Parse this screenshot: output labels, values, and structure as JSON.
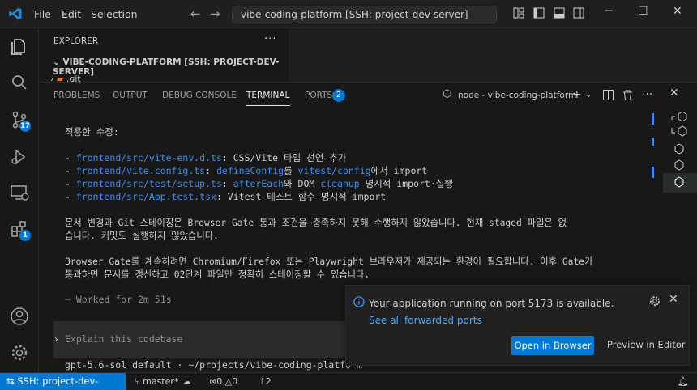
{
  "titlebar": {
    "menus": [
      "File",
      "Edit",
      "Selection"
    ],
    "command_center": "vibe-coding-platform [SSH: project-dev-server]"
  },
  "activity": {
    "source_control_badge": "17",
    "extensions_badge": "1"
  },
  "sidebar": {
    "title": "EXPLORER",
    "more": "···",
    "project": "VIBE-CODING-PLATFORM [SSH: PROJECT-DEV-SERVER]",
    "first_item": ".git"
  },
  "panel": {
    "tabs": [
      "PROBLEMS",
      "OUTPUT",
      "DEBUG CONSOLE",
      "TERMINAL",
      "PORTS"
    ],
    "active_tab": "TERMINAL",
    "ports_badge": "2",
    "terminal_name": "node - vibe-coding-platform"
  },
  "terminal": {
    "heading": "적용한 수정:",
    "items": [
      {
        "path": "frontend/src/vite-env.d.ts",
        "rest": ": CSS/Vite 타입 선언 추가"
      },
      {
        "path": "frontend/vite.config.ts",
        "mid1": ": ",
        "code1": "defineConfig",
        "mid2": "를 ",
        "code2": "vitest/config",
        "rest": "에서 import"
      },
      {
        "path": "frontend/src/test/setup.ts",
        "mid1": ": ",
        "code1": "afterEach",
        "mid2": "와 DOM ",
        "code2": "cleanup",
        "rest": " 명시적 import·실행"
      },
      {
        "path": "frontend/src/App.test.tsx",
        "rest": ": Vitest 테스트 함수 명시적 import"
      }
    ],
    "para1_line1": "문서 변경과 Git 스테이징은 Browser Gate 통과 조건을 충족하지 못해 수행하지 않았습니다. 현재 staged 파일은 없",
    "para1_line2": "습니다. 커밋도 실행하지 않았습니다.",
    "para2_line1": "Browser Gate를 계속하려면 Chromium/Firefox 또는 Playwright 브라우저가 제공되는 환경이 필요합니다. 이후 Gate가",
    "para2_line2": "통과하면 문서를 갱신하고 02단계 파일만 정확히 스테이징할 수 있습니다.",
    "worked": "─ Worked for 2m 51s ",
    "prompt_symbol": "›",
    "prompt_placeholder": "Explain this codebase",
    "footer": "gpt-5.6-sol default · ~/projects/vibe-coding-platform"
  },
  "notification": {
    "message": "Your application running on port 5173 is available.",
    "link": "See all forwarded ports",
    "primary": "Open in Browser",
    "secondary": "Preview in Editor"
  },
  "statusbar": {
    "remote": "SSH: project-dev-server",
    "branch": "master*",
    "errors": "0",
    "warnings": "0",
    "ports": "2"
  },
  "colors": {
    "accent": "#0078d4",
    "link": "#3b8eea",
    "background": "#181818"
  }
}
